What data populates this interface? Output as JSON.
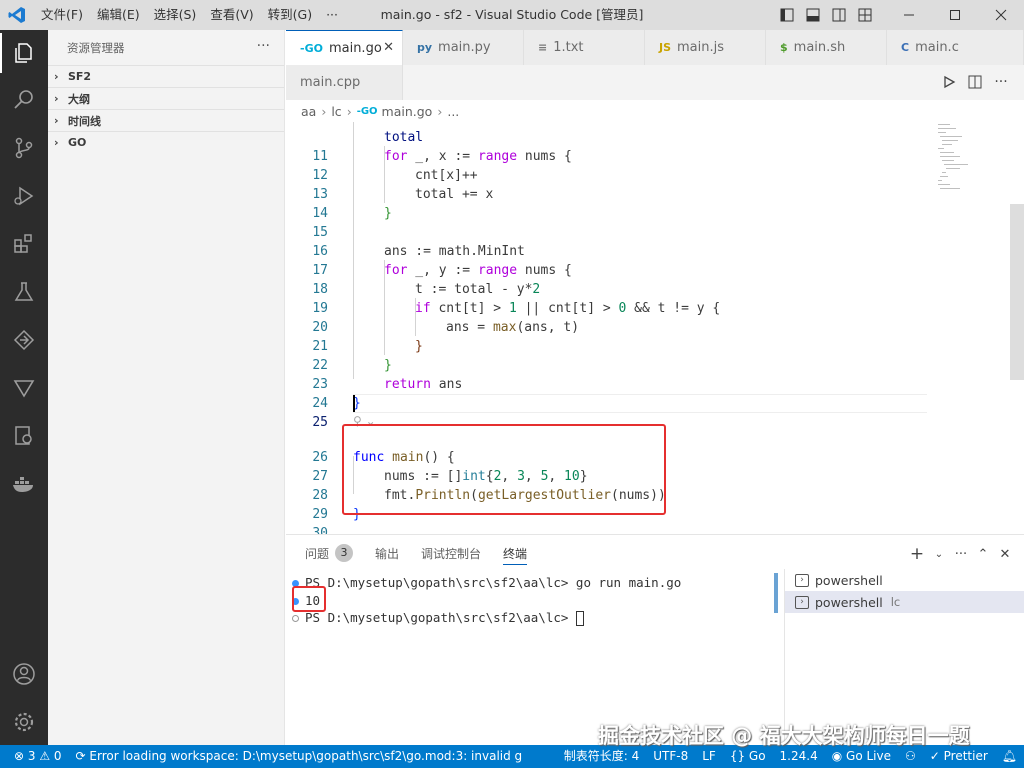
{
  "titlebar": {
    "menu": [
      "文件(F)",
      "编辑(E)",
      "选择(S)",
      "查看(V)",
      "转到(G)",
      "···"
    ],
    "title": "main.go - sf2 - Visual Studio Code [管理员]"
  },
  "sidebar": {
    "header": "资源管理器",
    "more": "···",
    "sections": [
      "SF2",
      "大纲",
      "时间线",
      "GO"
    ]
  },
  "tabs": [
    {
      "label": "main.go",
      "icon": "-GO",
      "active": true
    },
    {
      "label": "main.py",
      "icon": "py"
    },
    {
      "label": "1.txt",
      "icon": "≡"
    },
    {
      "label": "main.js",
      "icon": "JS"
    },
    {
      "label": "main.sh",
      "icon": "$"
    },
    {
      "label": "main.c",
      "icon": "C"
    },
    {
      "label": "main.cpp",
      "icon": "C++"
    }
  ],
  "breadcrumb": [
    "aa",
    "lc",
    "main.go",
    "..."
  ],
  "code": {
    "l11": {
      "n": "11",
      "for": "for",
      "mid": " _, x := ",
      "range": "range",
      "tail": " nums {"
    },
    "l12": {
      "n": "12",
      "text": "cnt[x]++"
    },
    "l13": {
      "n": "13",
      "text": "total += x"
    },
    "l14": {
      "n": "14",
      "text": "}"
    },
    "l15": {
      "n": "15"
    },
    "l16": {
      "n": "16",
      "text": "ans := math.MinInt"
    },
    "l17": {
      "n": "17",
      "for": "for",
      "mid": " _, y := ",
      "range": "range",
      "tail": " nums {"
    },
    "l18": {
      "n": "18",
      "a": "t := total - y*",
      "b": "2"
    },
    "l19": {
      "n": "19",
      "if": "if",
      "a": " cnt[t] > ",
      "one": "1",
      "b": " || cnt[t] > ",
      "zero": "0",
      "c": " && t != y {"
    },
    "l20": {
      "n": "20",
      "a": "ans = ",
      "fn": "max",
      "b": "(ans, t)"
    },
    "l21": {
      "n": "21",
      "text": "}"
    },
    "l22": {
      "n": "22",
      "text": "}"
    },
    "l23": {
      "n": "23",
      "ret": "return",
      "b": " ans"
    },
    "l24": {
      "n": "24",
      "text": "}"
    },
    "l25": {
      "n": "25"
    },
    "l26": {
      "n": "26",
      "func": "func",
      "sp": " ",
      "fn": "main",
      "b": "() {"
    },
    "l27": {
      "n": "27",
      "a": "nums := []",
      "typ": "int",
      "b": "{",
      "v1": "2",
      "c1": ", ",
      "v2": "3",
      "c2": ", ",
      "v3": "5",
      "c3": ", ",
      "v4": "10",
      "d": "}"
    },
    "l28": {
      "n": "28",
      "pkg": "fmt.",
      "fn1": "Println",
      "b": "(",
      "fn2": "getLargestOutlier",
      "c": "(nums))"
    },
    "l29": {
      "n": "29",
      "text": "}"
    },
    "l30": {
      "n": "30"
    }
  },
  "panel": {
    "tabs": [
      "问题",
      "输出",
      "调试控制台",
      "终端"
    ],
    "problems_count": "3",
    "terminal": {
      "line1": "PS D:\\mysetup\\gopath\\src\\sf2\\aa\\lc> go run main.go",
      "line2": "10",
      "line3": "PS D:\\mysetup\\gopath\\src\\sf2\\aa\\lc> "
    },
    "terminal_list": [
      {
        "label": "powershell",
        "sub": ""
      },
      {
        "label": "powershell",
        "sub": "lc"
      }
    ]
  },
  "statusbar": {
    "errors": "⊗ 3 ⚠ 0",
    "workspace_error": "Error loading workspace: D:\\mysetup\\gopath\\src\\sf2\\go.mod:3: invalid g",
    "tab_size": "制表符长度: 4",
    "encoding": "UTF-8",
    "eol": "LF",
    "language": "{} Go",
    "version": "1.24.4",
    "go_live": "Go Live",
    "prettier": "✓ Prettier"
  },
  "watermark": "掘金技术社区 @ 福大大架构师每日一题",
  "colors": {
    "accent": "#007acc",
    "highlight_box": "#e52f2f",
    "activity_bar": "#2c2c2c"
  }
}
